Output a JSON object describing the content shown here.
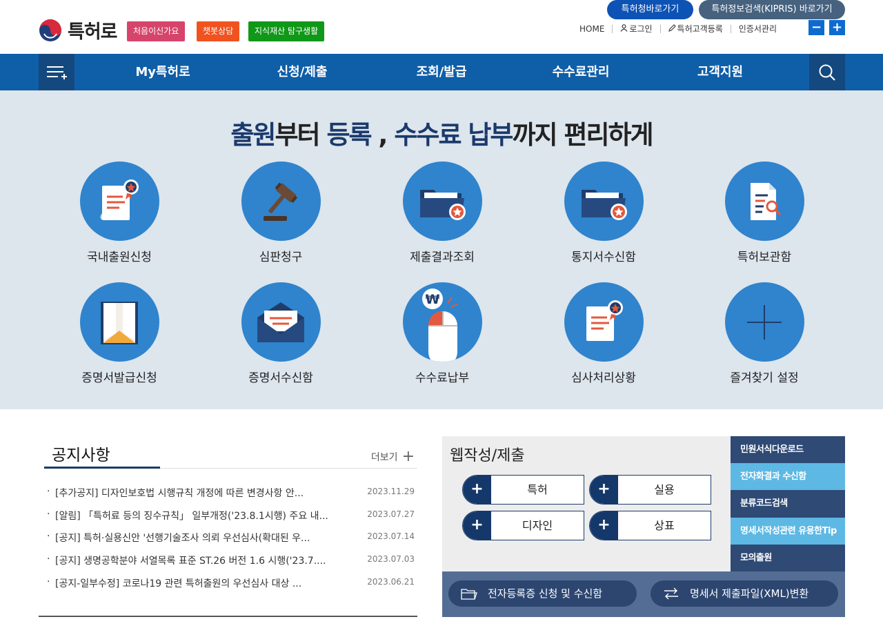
{
  "header": {
    "logo_text": "특허로",
    "quick_buttons": [
      "처음이신가요",
      "챗봇상담",
      "지식재산 탐구생활"
    ],
    "top_buttons": [
      "특허청바로가기",
      "특허정보검색(KIPRIS) 바로가기"
    ],
    "util_links": [
      "HOME",
      "로그인",
      "특허고객등록",
      "인증서관리"
    ],
    "zoom_out": "−",
    "zoom_in": "+",
    "colors": {
      "quick1": "#d6446b",
      "quick2": "#f0531f",
      "quick3": "#109818",
      "topbtn1": "#0d53b5",
      "topbtn2": "#46627f"
    }
  },
  "nav": {
    "items": [
      "My특허로",
      "신청/제출",
      "조회/발급",
      "수수료관리",
      "고객지원"
    ],
    "menu_icon": "menu-icon",
    "search_icon": "search-icon",
    "color": "#0f5ea8"
  },
  "hero": {
    "headline": {
      "p1": "출원",
      "p2": "부터 ",
      "p3": "등록",
      "p4": " , ",
      "p5": "수수료 납부",
      "p6": "까지 편리하게"
    },
    "services": [
      {
        "label": "국내출원신청",
        "icon": "document-badge-icon"
      },
      {
        "label": "심판청구",
        "icon": "gavel-icon"
      },
      {
        "label": "제출결과조회",
        "icon": "folder-badge-icon"
      },
      {
        "label": "통지서수신함",
        "icon": "folder-badge-icon"
      },
      {
        "label": "특허보관함",
        "icon": "document-search-icon"
      },
      {
        "label": "증명서발급신청",
        "icon": "envelope-open-icon"
      },
      {
        "label": "증명서수신함",
        "icon": "mail-icon"
      },
      {
        "label": "수수료납부",
        "icon": "mouse-won-icon"
      },
      {
        "label": "심사처리상황",
        "icon": "document-badge-icon"
      },
      {
        "label": "즐겨찾기 설정",
        "icon": "plus-icon"
      }
    ]
  },
  "notice": {
    "title": "공지사항",
    "more": "더보기",
    "items": [
      {
        "text": "[추가공지] 디자인보호법 시행규칙 개정에 따른 변경사항 안...",
        "date": "2023.11.29"
      },
      {
        "text": "[알림] 「특허료 등의 징수규칙」 일부개정('23.8.1시행) 주요 내...",
        "date": "2023.07.27"
      },
      {
        "text": "[공지] 특허·실용신안 '선행기술조사 의뢰 우선심사(확대된 우...",
        "date": "2023.07.14"
      },
      {
        "text": "[공지] 생명공학분야 서열목록 표준 ST.26 버전 1.6 시행('23.7....",
        "date": "2023.07.03"
      },
      {
        "text": "[공지-일부수정] 코로나19 관련 특허출원의 우선심사 대상 ...",
        "date": "2023.06.21"
      }
    ]
  },
  "web": {
    "title": "웹작성/제출",
    "buttons": [
      "특허",
      "실용",
      "디자인",
      "상표"
    ]
  },
  "side_links": [
    "민원서식다운로드",
    "전자화결과 수신함",
    "분류코드검색",
    "명세서작성관련 유용한Tip",
    "모의출원"
  ],
  "bottom_buttons": [
    "전자등록증 신청 및 수신함",
    "명세서 제출파일(XML)변환"
  ]
}
